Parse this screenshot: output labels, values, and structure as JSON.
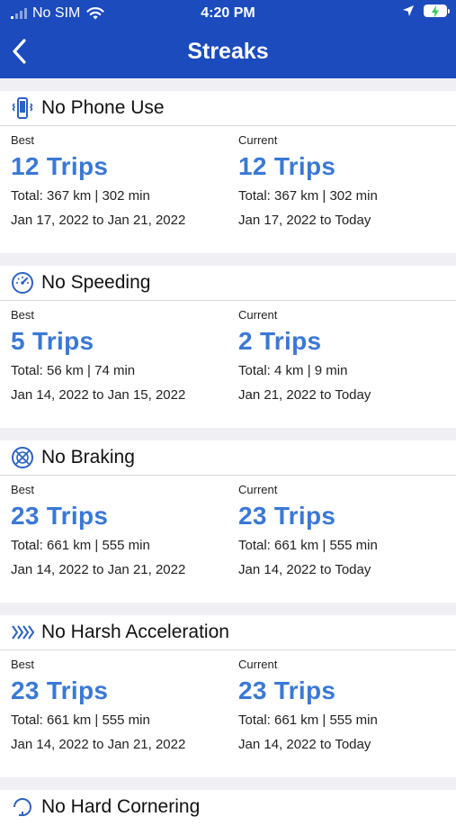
{
  "status_bar": {
    "carrier": "No SIM",
    "time": "4:20 PM"
  },
  "navbar": {
    "title": "Streaks"
  },
  "labels": {
    "best": "Best",
    "current": "Current"
  },
  "streaks": [
    {
      "name": "No Phone Use",
      "icon": "phone-vibrate-icon",
      "best": {
        "trips": "12 Trips",
        "total": "Total: 367 km | 302 min",
        "range": "Jan 17, 2022 to Jan 21, 2022"
      },
      "current": {
        "trips": "12 Trips",
        "total": "Total: 367 km | 302 min",
        "range": "Jan 17, 2022 to Today"
      }
    },
    {
      "name": "No Speeding",
      "icon": "speedometer-icon",
      "best": {
        "trips": "5 Trips",
        "total": "Total: 56 km | 74 min",
        "range": "Jan 14, 2022 to Jan 15, 2022"
      },
      "current": {
        "trips": "2 Trips",
        "total": "Total: 4 km | 9 min",
        "range": "Jan 21, 2022 to Today"
      }
    },
    {
      "name": "No Braking",
      "icon": "brake-icon",
      "best": {
        "trips": "23 Trips",
        "total": "Total: 661 km | 555 min",
        "range": "Jan 14, 2022 to Jan 21, 2022"
      },
      "current": {
        "trips": "23 Trips",
        "total": "Total: 661 km | 555 min",
        "range": "Jan 14, 2022 to Today"
      }
    },
    {
      "name": "No Harsh Acceleration",
      "icon": "acceleration-icon",
      "best": {
        "trips": "23 Trips",
        "total": "Total: 661 km | 555 min",
        "range": "Jan 14, 2022 to Jan 21, 2022"
      },
      "current": {
        "trips": "23 Trips",
        "total": "Total: 661 km | 555 min",
        "range": "Jan 14, 2022 to Today"
      }
    },
    {
      "name": "No Hard Cornering",
      "icon": "cornering-icon"
    }
  ],
  "colors": {
    "header": "#1b4bbd",
    "trips": "#3a78d6"
  }
}
